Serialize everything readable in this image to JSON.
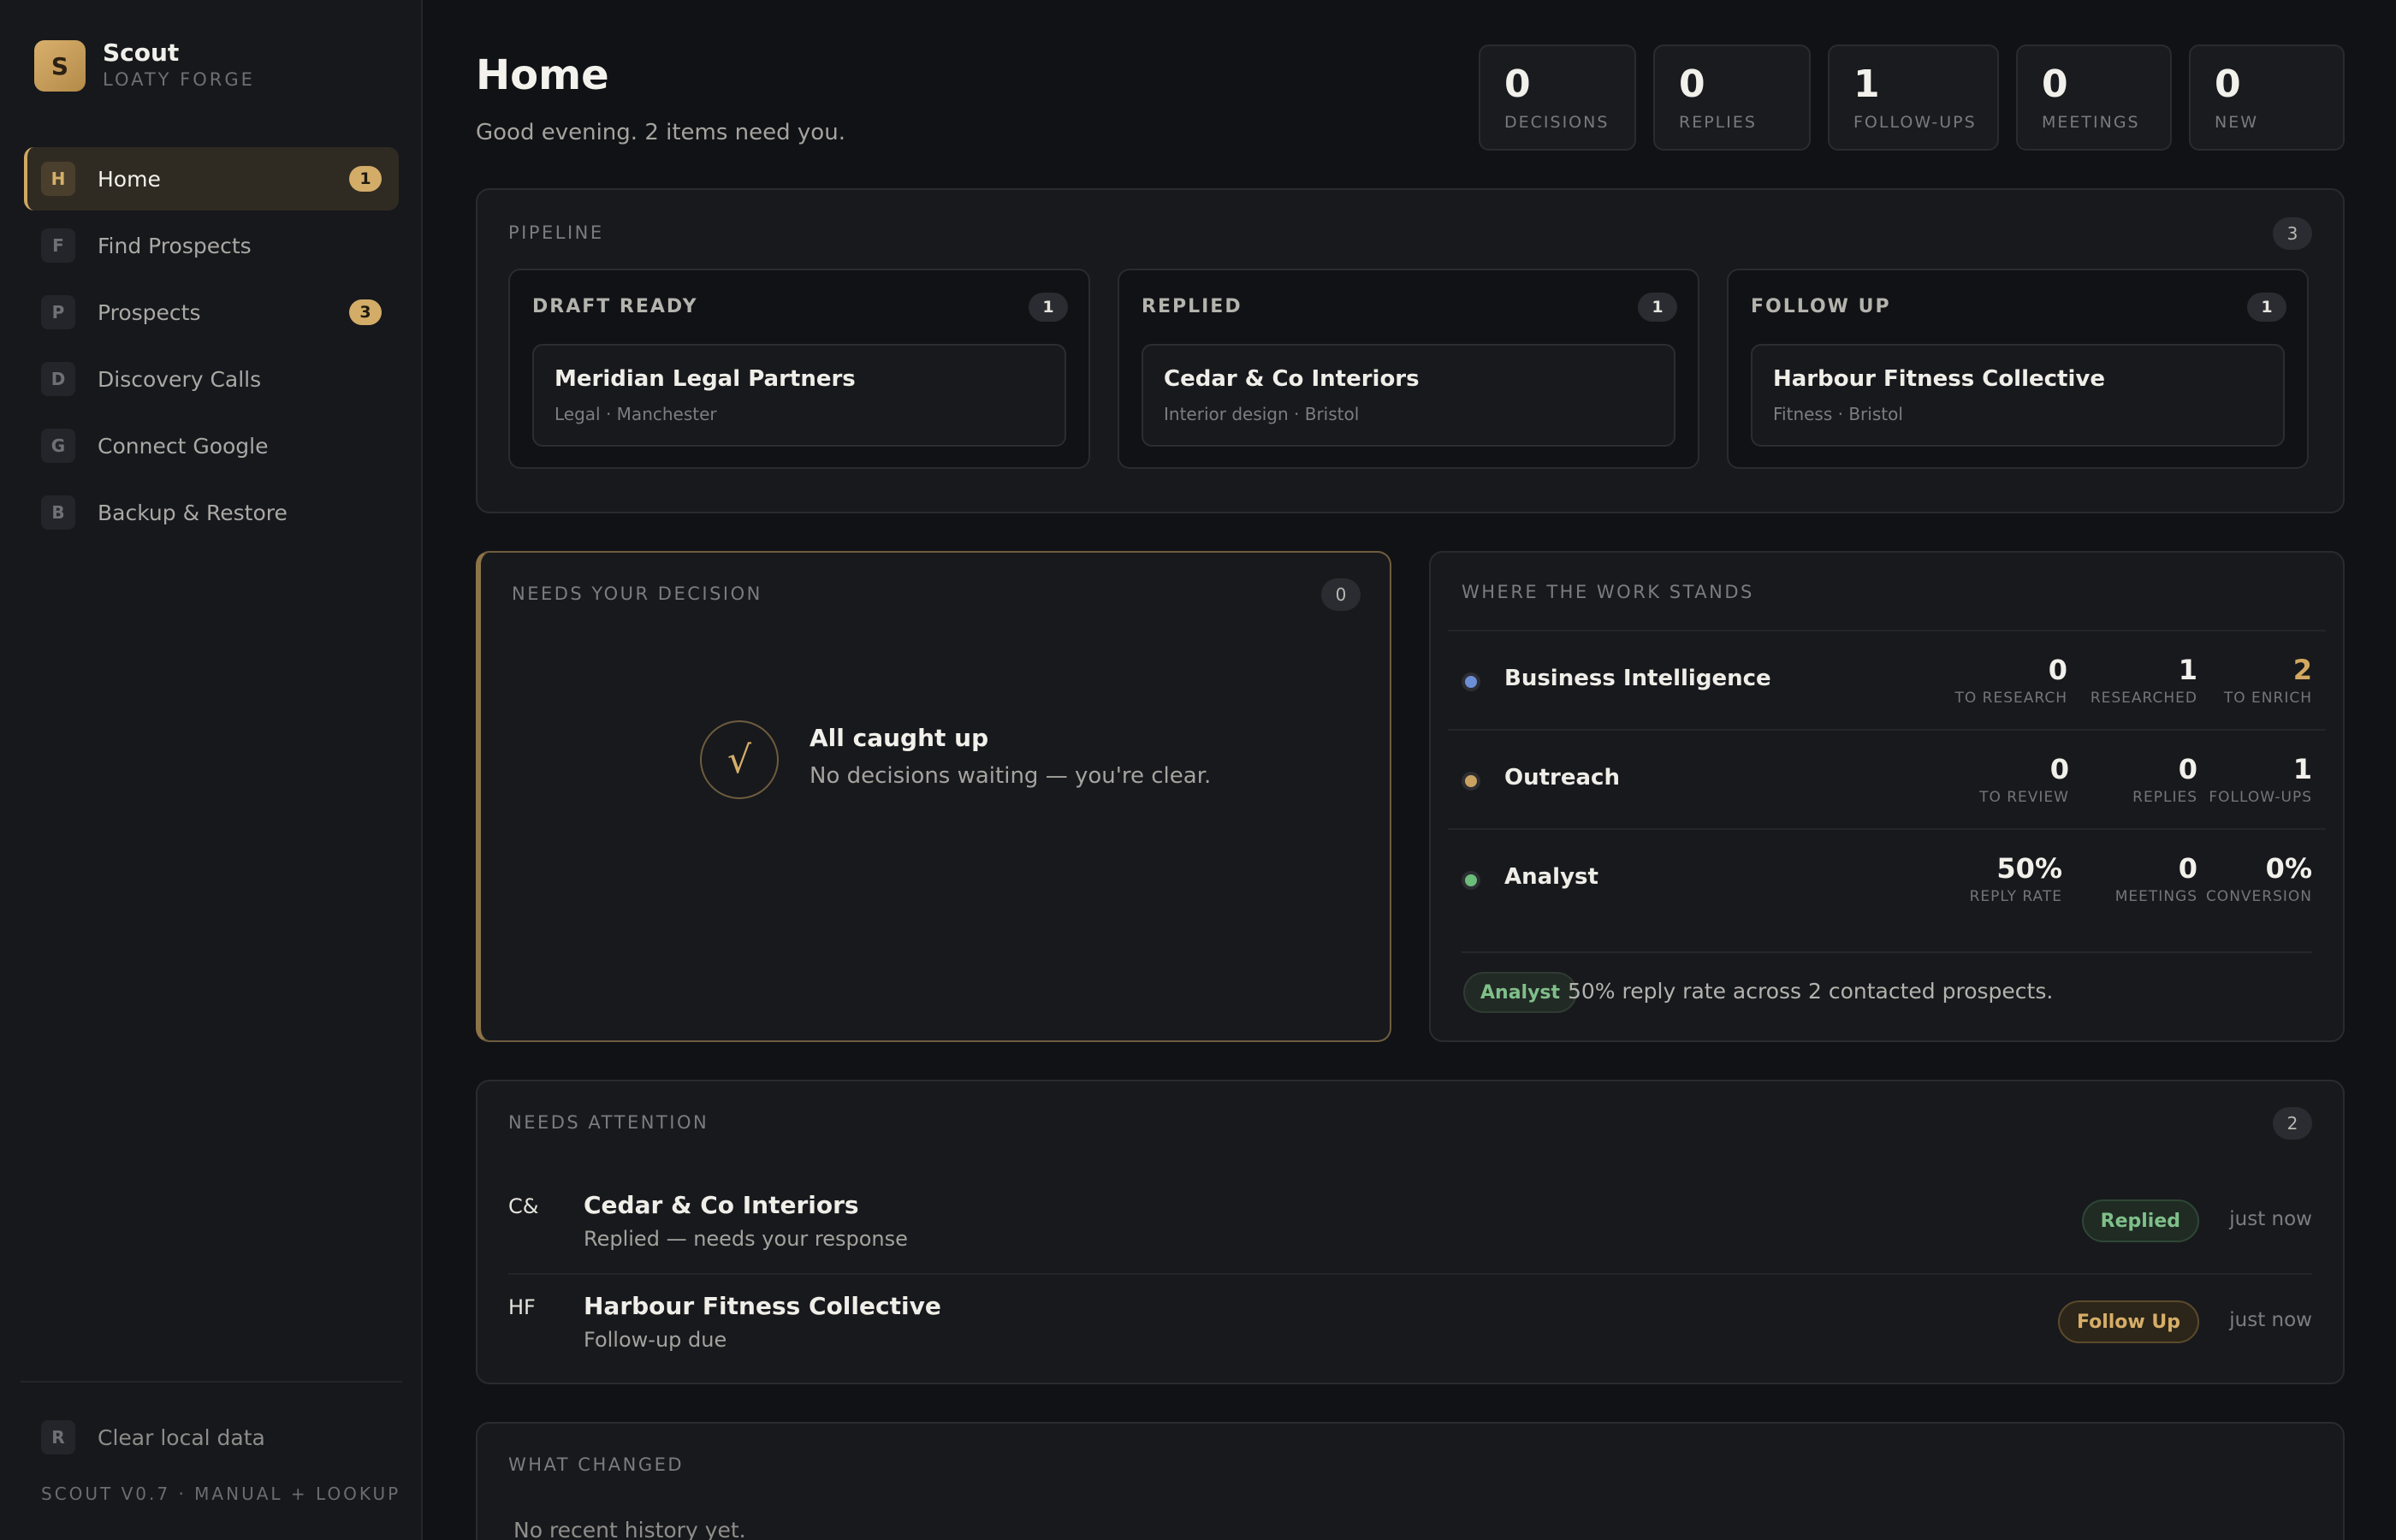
{
  "brand": {
    "logo_letter": "S",
    "name": "Scout",
    "org": "LOATY FORGE"
  },
  "sidebar": {
    "items": [
      {
        "key": "H",
        "label": "Home",
        "badge": "1",
        "active": true
      },
      {
        "key": "F",
        "label": "Find Prospects",
        "badge": null
      },
      {
        "key": "P",
        "label": "Prospects",
        "badge": "3"
      },
      {
        "key": "D",
        "label": "Discovery Calls",
        "badge": null
      },
      {
        "key": "G",
        "label": "Connect Google",
        "badge": null
      },
      {
        "key": "B",
        "label": "Backup & Restore",
        "badge": null
      }
    ],
    "footer_item": {
      "key": "R",
      "label": "Clear local data"
    },
    "version": "SCOUT V0.7 · MANUAL + LOOKUP"
  },
  "header": {
    "title": "Home",
    "subtitle": "Good evening. 2 items need you."
  },
  "stats": [
    {
      "value": "0",
      "label": "DECISIONS"
    },
    {
      "value": "0",
      "label": "REPLIES"
    },
    {
      "value": "1",
      "label": "FOLLOW-UPS"
    },
    {
      "value": "0",
      "label": "MEETINGS"
    },
    {
      "value": "0",
      "label": "NEW"
    }
  ],
  "pipeline": {
    "title": "PIPELINE",
    "count": "3",
    "columns": [
      {
        "label": "DRAFT READY",
        "count": "1",
        "card": {
          "name": "Meridian Legal Partners",
          "meta": "Legal · Manchester"
        }
      },
      {
        "label": "REPLIED",
        "count": "1",
        "card": {
          "name": "Cedar & Co Interiors",
          "meta": "Interior design · Bristol"
        }
      },
      {
        "label": "FOLLOW UP",
        "count": "1",
        "card": {
          "name": "Harbour Fitness Collective",
          "meta": "Fitness · Bristol"
        }
      }
    ]
  },
  "decision": {
    "title": "NEEDS YOUR DECISION",
    "count": "0",
    "check_glyph": "√",
    "empty_title": "All caught up",
    "empty_sub": "No decisions waiting — you're clear."
  },
  "work": {
    "title": "WHERE THE WORK STANDS",
    "rows": [
      {
        "name": "Business Intelligence",
        "dot": "#6c8fd6",
        "metrics": [
          {
            "value": "0",
            "label": "TO RESEARCH"
          },
          {
            "value": "1",
            "label": "RESEARCHED"
          },
          {
            "value": "2",
            "label": "TO ENRICH",
            "color": "#d4a860"
          }
        ]
      },
      {
        "name": "Outreach",
        "dot": "#c9a262",
        "metrics": [
          {
            "value": "0",
            "label": "TO REVIEW"
          },
          {
            "value": "0",
            "label": "REPLIES"
          },
          {
            "value": "1",
            "label": "FOLLOW-UPS"
          }
        ]
      },
      {
        "name": "Analyst",
        "dot": "#6cbd7a",
        "metrics": [
          {
            "value": "50%",
            "label": "REPLY RATE"
          },
          {
            "value": "0",
            "label": "MEETINGS"
          },
          {
            "value": "0%",
            "label": "CONVERSION"
          }
        ]
      }
    ],
    "footer_tag": "Analyst",
    "footer_text": "50% reply rate across 2 contacted prospects."
  },
  "attention": {
    "title": "NEEDS ATTENTION",
    "count": "2",
    "items": [
      {
        "initials": "C&",
        "name": "Cedar & Co Interiors",
        "sub": "Replied — needs your response",
        "tag": "Replied",
        "time": "just now"
      },
      {
        "initials": "HF",
        "name": "Harbour Fitness Collective",
        "sub": "Follow-up due",
        "tag": "Follow Up",
        "time": "just now"
      }
    ]
  },
  "history": {
    "title": "WHAT CHANGED",
    "empty": "No recent history yet."
  },
  "colors": {
    "accent": "#d3ac68",
    "background": "#111215",
    "panel": "#18191d",
    "success": "#7fbf8a"
  }
}
